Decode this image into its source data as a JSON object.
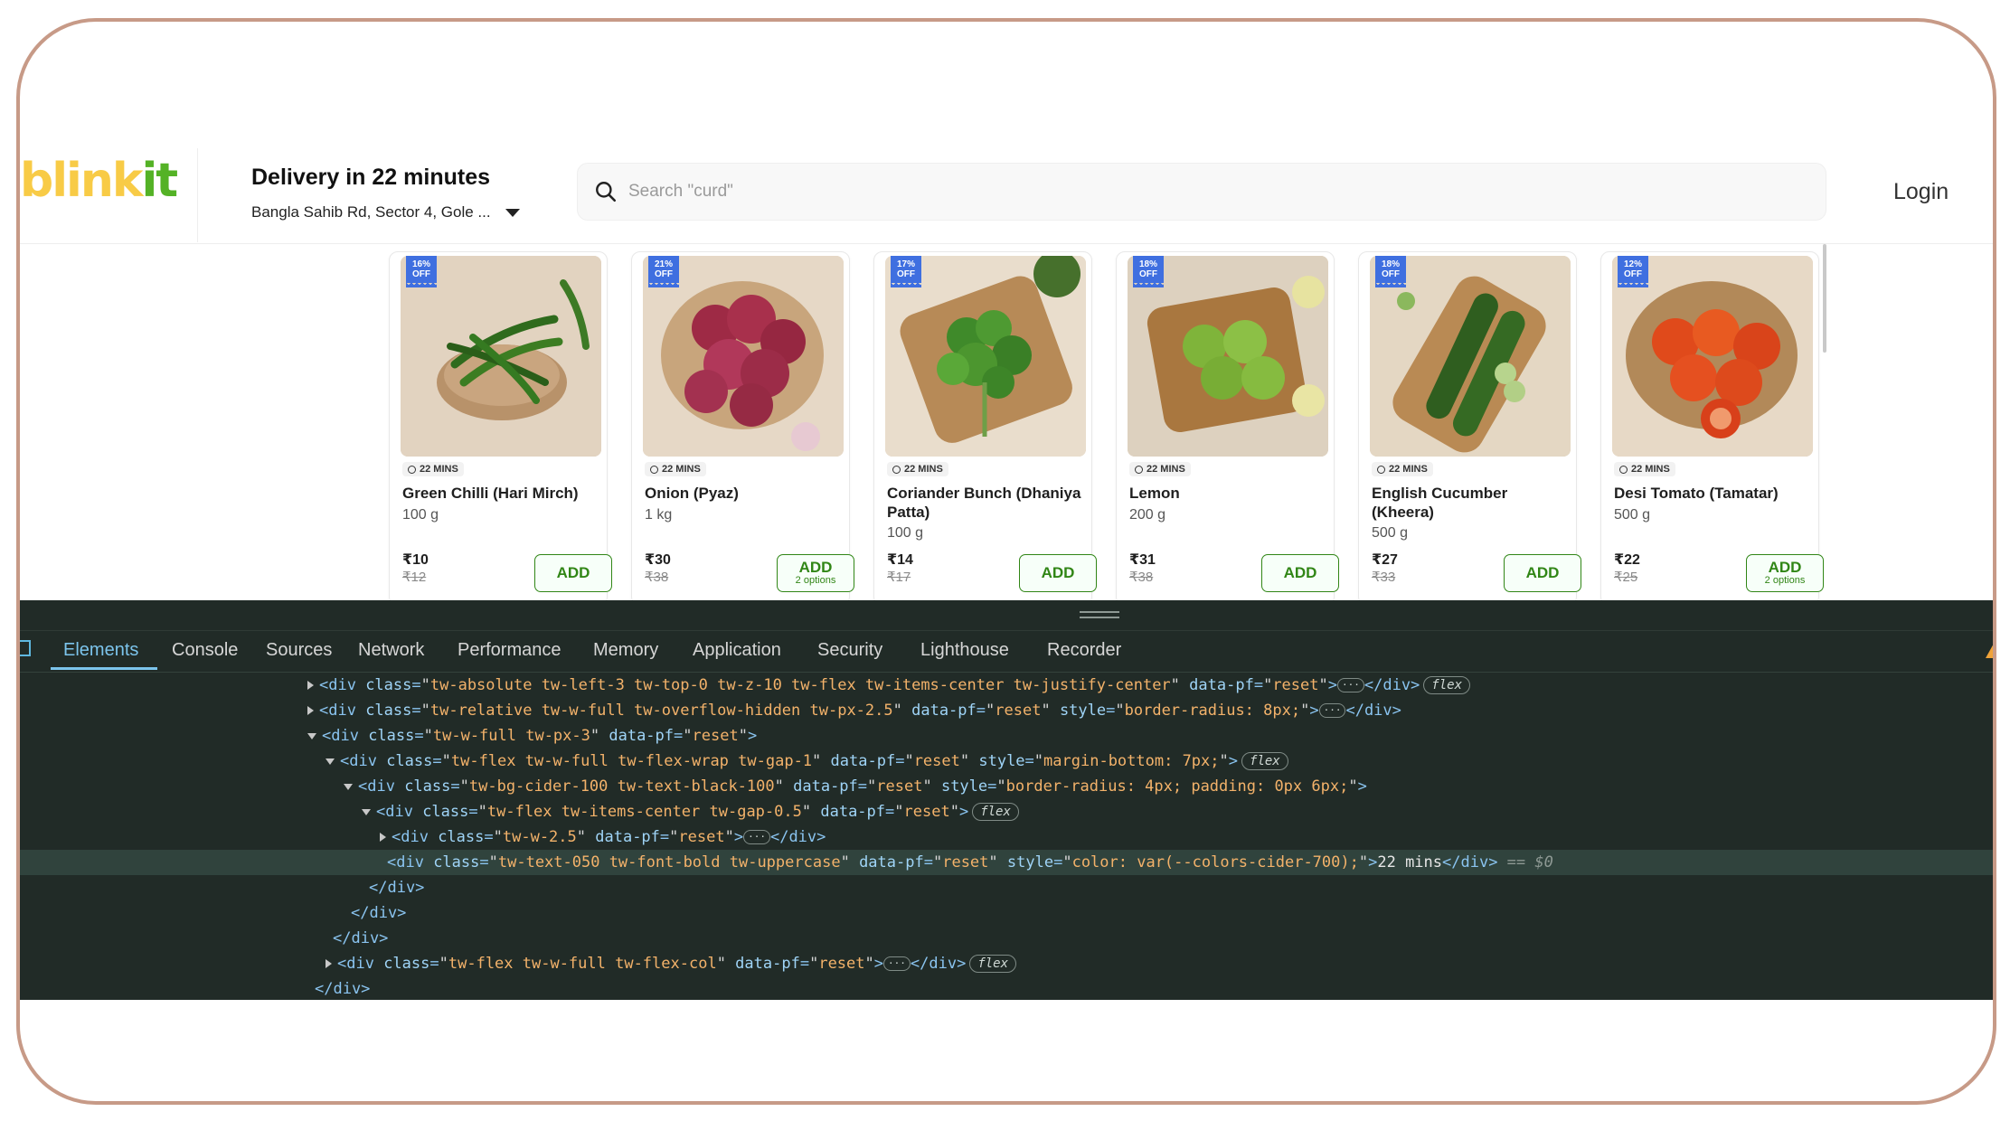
{
  "brand": {
    "part1": "blink",
    "part2": "it"
  },
  "delivery": {
    "title": "Delivery in 22 minutes",
    "address": "Bangla Sahib Rd, Sector 4, Gole ..."
  },
  "search": {
    "placeholder": "Search \"curd\""
  },
  "login_label": "Login",
  "products": [
    {
      "discount": "16% OFF",
      "time": "22 MINS",
      "name": "Green Chilli (Hari Mirch)",
      "qty": "100 g",
      "price": "₹10",
      "mrp": "₹12",
      "add": "ADD",
      "options": ""
    },
    {
      "discount": "21% OFF",
      "time": "22 MINS",
      "name": "Onion (Pyaz)",
      "qty": "1 kg",
      "price": "₹30",
      "mrp": "₹38",
      "add": "ADD",
      "options": "2 options"
    },
    {
      "discount": "17% OFF",
      "time": "22 MINS",
      "name": "Coriander Bunch (Dhaniya Patta)",
      "qty": "100 g",
      "price": "₹14",
      "mrp": "₹17",
      "add": "ADD",
      "options": ""
    },
    {
      "discount": "18% OFF",
      "time": "22 MINS",
      "name": "Lemon",
      "qty": "200 g",
      "price": "₹31",
      "mrp": "₹38",
      "add": "ADD",
      "options": ""
    },
    {
      "discount": "18% OFF",
      "time": "22 MINS",
      "name": "English Cucumber (Kheera)",
      "qty": "500 g",
      "price": "₹27",
      "mrp": "₹33",
      "add": "ADD",
      "options": ""
    },
    {
      "discount": "12% OFF",
      "time": "22 MINS",
      "name": "Desi Tomato (Tamatar)",
      "qty": "500 g",
      "price": "₹22",
      "mrp": "₹25",
      "add": "ADD",
      "options": "2 options"
    }
  ],
  "devtools": {
    "tabs": [
      "Elements",
      "Console",
      "Sources",
      "Network",
      "Performance",
      "Memory",
      "Application",
      "Security",
      "Lighthouse",
      "Recorder"
    ],
    "lines": [
      {
        "tag": "<div ",
        "attrs": [
          [
            "class",
            "tw-absolute tw-left-3 tw-top-0 tw-z-10 tw-flex tw-items-center tw-justify-center"
          ],
          [
            "data-pf",
            "reset"
          ]
        ],
        "tail": ">",
        "collapsed": true,
        "close": "</div>",
        "pill": "flex"
      },
      {
        "tag": "<div ",
        "attrs": [
          [
            "class",
            "tw-relative tw-w-full tw-overflow-hidden tw-px-2.5"
          ],
          [
            "data-pf",
            "reset"
          ],
          [
            "style",
            "border-radius: 8px;"
          ]
        ],
        "tail": ">",
        "collapsed": true,
        "close": "</div>",
        "pill": ""
      },
      {
        "tag": "<div ",
        "attrs": [
          [
            "class",
            "tw-w-full tw-px-3"
          ],
          [
            "data-pf",
            "reset"
          ]
        ],
        "tail": ">",
        "collapsed": false,
        "close": "",
        "pill": ""
      },
      {
        "tag": "<div ",
        "attrs": [
          [
            "class",
            "tw-flex tw-w-full tw-flex-wrap tw-gap-1"
          ],
          [
            "data-pf",
            "reset"
          ],
          [
            "style",
            "margin-bottom: 7px;"
          ]
        ],
        "tail": ">",
        "collapsed": false,
        "close": "",
        "pill": "flex"
      },
      {
        "tag": "<div ",
        "attrs": [
          [
            "class",
            "tw-bg-cider-100 tw-text-black-100"
          ],
          [
            "data-pf",
            "reset"
          ],
          [
            "style",
            "border-radius: 4px; padding: 0px 6px;"
          ]
        ],
        "tail": ">",
        "collapsed": false,
        "close": "",
        "pill": ""
      },
      {
        "tag": "<div ",
        "attrs": [
          [
            "class",
            "tw-flex tw-items-center tw-gap-0.5"
          ],
          [
            "data-pf",
            "reset"
          ]
        ],
        "tail": ">",
        "collapsed": false,
        "close": "",
        "pill": "flex"
      },
      {
        "tag": "<div ",
        "attrs": [
          [
            "class",
            "tw-w-2.5"
          ],
          [
            "data-pf",
            "reset"
          ]
        ],
        "tail": ">",
        "collapsed": true,
        "close": "</div>",
        "pill": ""
      },
      {
        "tag": "<div ",
        "attrs": [
          [
            "class",
            "tw-text-050 tw-font-bold tw-uppercase"
          ],
          [
            "data-pf",
            "reset"
          ],
          [
            "style",
            "color: var(--colors-cider-700);"
          ]
        ],
        "tail": ">",
        "text": "22 mins",
        "close": "</div>",
        "selected": " == $0",
        "pill": ""
      },
      {
        "tag": "</div>",
        "attrs": [],
        "tail": "",
        "close": "",
        "pill": ""
      },
      {
        "tag": "</div>",
        "attrs": [],
        "tail": "",
        "close": "",
        "pill": ""
      },
      {
        "tag": "</div>",
        "attrs": [],
        "tail": "",
        "close": "",
        "pill": ""
      },
      {
        "tag": "<div ",
        "attrs": [
          [
            "class",
            "tw-flex tw-w-full tw-flex-col"
          ],
          [
            "data-pf",
            "reset"
          ]
        ],
        "tail": ">",
        "collapsed": true,
        "close": "</div>",
        "pill": "flex"
      },
      {
        "tag": "</div>",
        "attrs": [],
        "tail": "",
        "close": "",
        "pill": ""
      }
    ]
  },
  "colors": {
    "accent_green": "#318616",
    "brand_yellow": "#f8cb46",
    "brand_green": "#54b226",
    "badge_blue": "#3f6fe0",
    "devtools_bg": "#212b27"
  }
}
